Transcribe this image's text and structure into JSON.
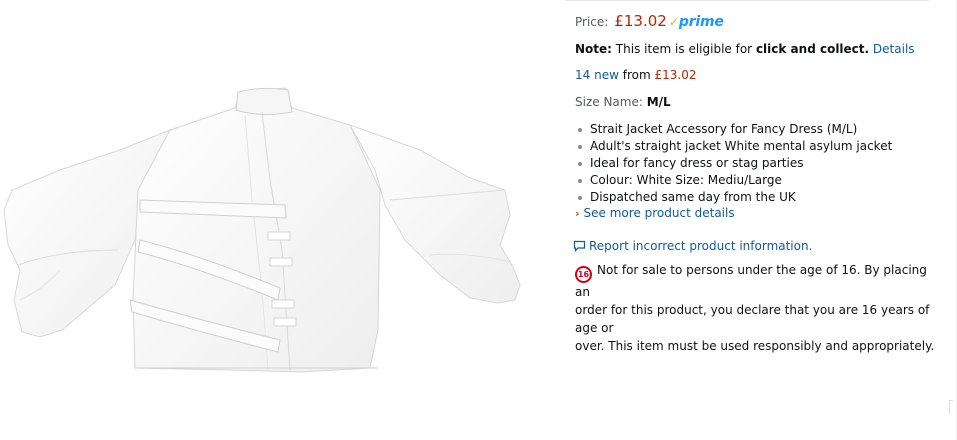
{
  "product": {
    "image_alt": "White strait jacket"
  },
  "price": {
    "label": "Price:",
    "value": "£13.02",
    "prime_check": "✓",
    "prime_label": "prime"
  },
  "note": {
    "label": "Note:",
    "text": "This item is eligible for",
    "highlight": "click and collect.",
    "link": "Details"
  },
  "offers": {
    "count_link": "14 new",
    "from_text": "from",
    "from_price": "£13.02"
  },
  "size": {
    "label": "Size Name:",
    "value": "M/L"
  },
  "bullets": [
    "Strait Jacket Accessory for Fancy Dress (M/L)",
    "Adult's straight jacket White mental asylum jacket",
    "Ideal for fancy dress or stag parties",
    "Colour: White Size: Mediu/Large",
    "Dispatched same day from the UK"
  ],
  "see_more": {
    "chevron": "›",
    "label": "See more product details"
  },
  "report": {
    "label": "Report incorrect product information."
  },
  "age_restriction": {
    "badge": "16",
    "text_line1": "Not for sale to persons under the age of 16. By placing an",
    "text_line2": "order for this product, you declare that you are 16 years of age or",
    "text_line3": "over. This item must be used responsibly and appropriately."
  },
  "colors": {
    "price": "#b12704",
    "link": "#0f5a9c",
    "prime_blue": "#1a98ff",
    "prime_check": "#f7a81b",
    "age_badge": "#d0021b"
  },
  "icons": [
    "product-image",
    "prime-check-icon",
    "chevron-right-icon",
    "report-speech-bubble-icon",
    "age-16-badge-icon"
  ]
}
